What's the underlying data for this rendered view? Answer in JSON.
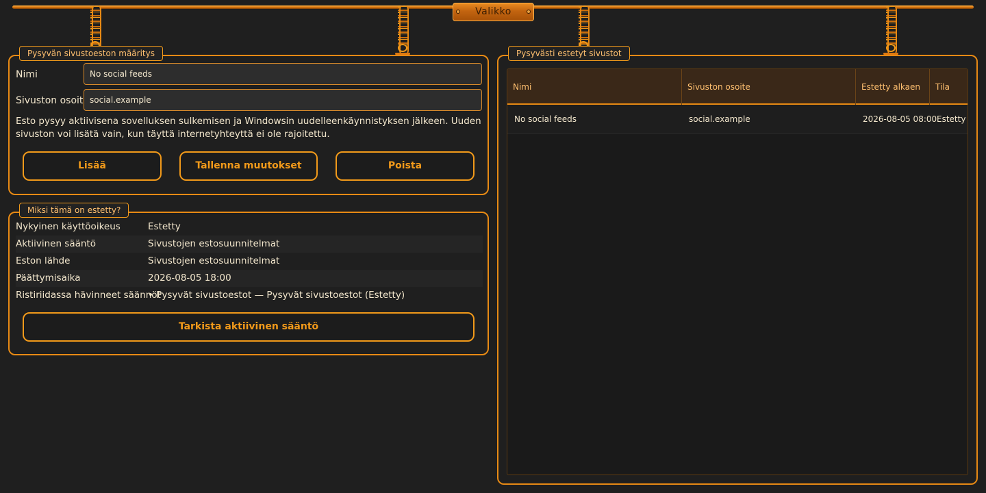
{
  "header": {
    "menu_label": "Valikko"
  },
  "definition": {
    "title": "Pysyvän sivustoeston määritys",
    "name_label": "Nimi",
    "name_value": "No social feeds",
    "address_label": "Sivuston osoite",
    "address_value": "social.example",
    "help": "Esto pysyy aktiivisena sovelluksen sulkemisen ja Windowsin uudelleenkäynnistyksen jälkeen. Uuden sivuston voi lisätä vain, kun täyttä internetyhteyttä ei ole rajoitettu.",
    "buttons": {
      "add": "Lisää",
      "save": "Tallenna muutokset",
      "delete": "Poista"
    }
  },
  "why": {
    "title": "Miksi tämä on estetty?",
    "rows": [
      {
        "key": "Nykyinen käyttöoikeus",
        "value": "Estetty"
      },
      {
        "key": "Aktiivinen sääntö",
        "value": "Sivustojen estosuunnitelmat"
      },
      {
        "key": "Eston lähde",
        "value": "Sivustojen estosuunnitelmat"
      },
      {
        "key": "Päättymisaika",
        "value": "2026-08-05 18:00"
      },
      {
        "key": "Ristiriidassa hävinneet säännöt",
        "value": "• Pysyvät sivustoestot — Pysyvät sivustoestot (Estetty)"
      }
    ],
    "check_button": "Tarkista aktiivinen sääntö"
  },
  "blocked": {
    "title": "Pysyvästi estetyt sivustot",
    "columns": [
      "Nimi",
      "Sivuston osoite",
      "Estetty alkaen",
      "Tila"
    ],
    "rows": [
      [
        "No social feeds",
        "social.example",
        "2026-08-05 08:00",
        "Estetty"
      ]
    ]
  }
}
